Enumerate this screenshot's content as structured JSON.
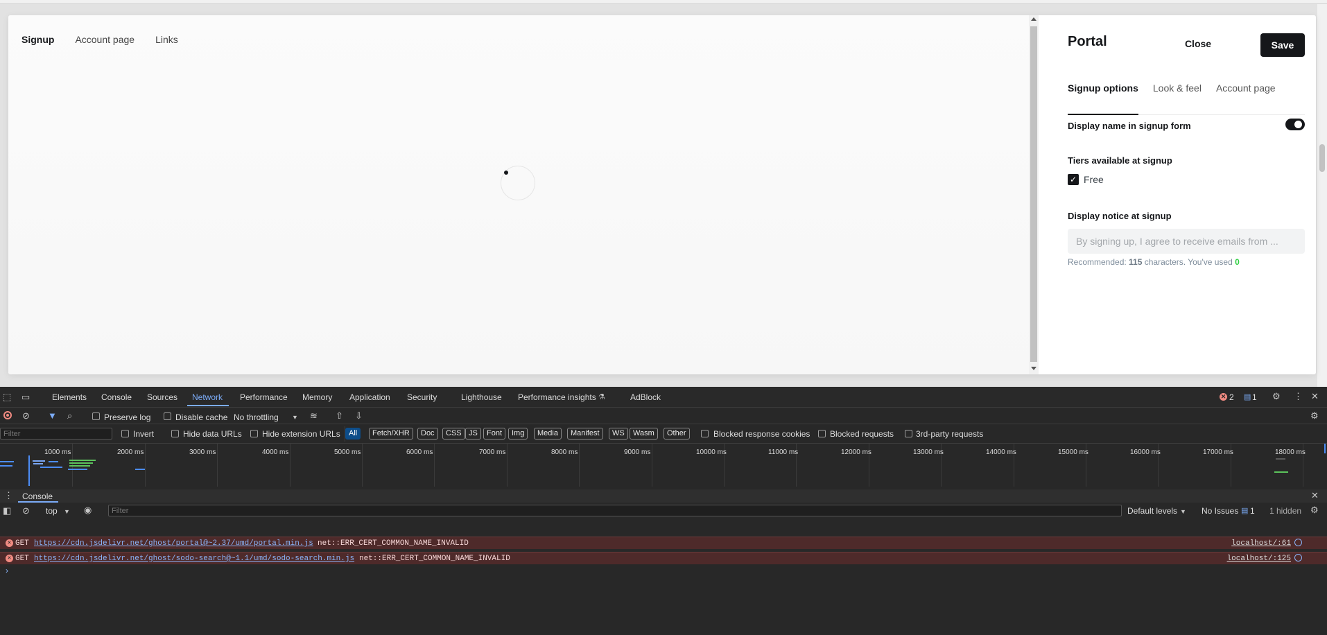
{
  "preview": {
    "tabs": [
      {
        "label": "Signup",
        "active": true
      },
      {
        "label": "Account page",
        "active": false
      },
      {
        "label": "Links",
        "active": false
      }
    ]
  },
  "portal": {
    "title": "Portal",
    "close_label": "Close",
    "save_label": "Save",
    "tabs": [
      {
        "label": "Signup options",
        "active": true
      },
      {
        "label": "Look & feel",
        "active": false
      },
      {
        "label": "Account page",
        "active": false
      }
    ],
    "display_name_label": "Display name in signup form",
    "display_name_enabled": true,
    "tiers_label": "Tiers available at signup",
    "tier_free_label": "Free",
    "tier_free_checked": true,
    "notice_label": "Display notice at signup",
    "notice_placeholder": "By signing up, I agree to receive emails from ...",
    "notice_hint_prefix": "Recommended: ",
    "notice_hint_count": "115",
    "notice_hint_middle": " characters. You've used ",
    "notice_hint_used": "0"
  },
  "devtools": {
    "tabs": [
      {
        "label": "Elements",
        "active": false
      },
      {
        "label": "Console",
        "active": false
      },
      {
        "label": "Sources",
        "active": false
      },
      {
        "label": "Network",
        "active": true
      },
      {
        "label": "Performance",
        "active": false
      },
      {
        "label": "Memory",
        "active": false
      },
      {
        "label": "Application",
        "active": false
      },
      {
        "label": "Security",
        "active": false
      },
      {
        "label": "Lighthouse",
        "active": false
      },
      {
        "label": "Performance insights",
        "active": false
      },
      {
        "label": "AdBlock",
        "active": false
      }
    ],
    "error_count": "2",
    "message_count": "1",
    "network": {
      "preserve_log": "Preserve log",
      "disable_cache": "Disable cache",
      "throttling": "No throttling",
      "filter_placeholder": "Filter",
      "invert": "Invert",
      "hide_data_urls": "Hide data URLs",
      "hide_extension_urls": "Hide extension URLs",
      "type_filters": [
        "All",
        "Fetch/XHR",
        "Doc",
        "CSS",
        "JS",
        "Font",
        "Img",
        "Media",
        "Manifest",
        "WS",
        "Wasm",
        "Other"
      ],
      "active_type_filter": "All",
      "blocked_cookies": "Blocked response cookies",
      "blocked_requests": "Blocked requests",
      "third_party": "3rd-party requests",
      "timeline_ticks": [
        "1000 ms",
        "2000 ms",
        "3000 ms",
        "4000 ms",
        "5000 ms",
        "6000 ms",
        "7000 ms",
        "8000 ms",
        "9000 ms",
        "10000 ms",
        "11000 ms",
        "12000 ms",
        "13000 ms",
        "14000 ms",
        "15000 ms",
        "16000 ms",
        "17000 ms",
        "18000 ms"
      ]
    },
    "console": {
      "drawer_title": "Console",
      "context": "top",
      "filter_placeholder": "Filter",
      "levels": "Default levels",
      "issues_label": "No Issues",
      "issues_count": "1",
      "hidden": "1 hidden",
      "logs": [
        {
          "method": "GET",
          "url": "https://cdn.jsdelivr.net/ghost/portal@~2.37/umd/portal.min.js",
          "message": "net::ERR_CERT_COMMON_NAME_INVALID",
          "source": "localhost/:61"
        },
        {
          "method": "GET",
          "url": "https://cdn.jsdelivr.net/ghost/sodo-search@~1.1/umd/sodo-search.min.js",
          "message": "net::ERR_CERT_COMMON_NAME_INVALID",
          "source": "localhost/:125"
        }
      ]
    }
  },
  "colors": {
    "accent_dark": "#15171a",
    "devtools_bg": "#282828",
    "devtools_accent": "#7cacf8",
    "error_row": "#4e2a2a",
    "success_green": "#30cf43"
  }
}
